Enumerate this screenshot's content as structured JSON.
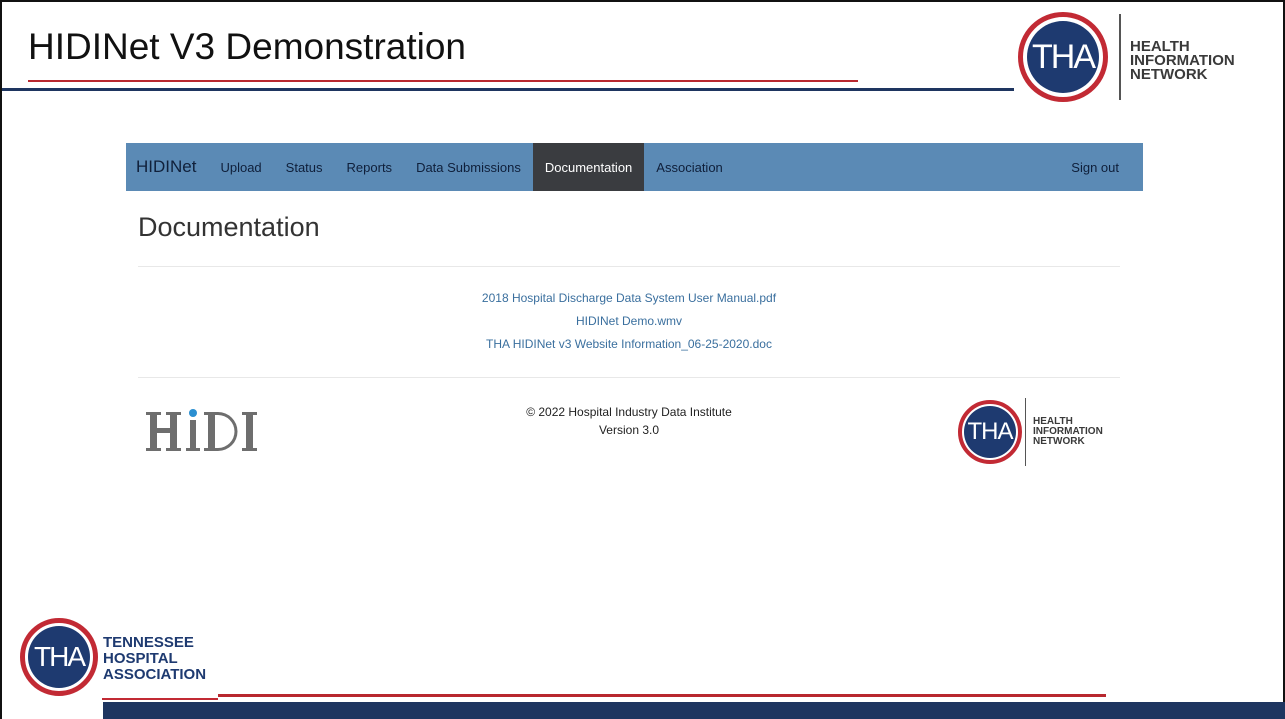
{
  "slide": {
    "title": "HIDINet V3 Demonstration",
    "header_logo": {
      "initials": "THA",
      "text_lines": [
        "HEALTH",
        "INFORMATION",
        "NETWORK"
      ]
    },
    "footer_logo": {
      "initials": "THA",
      "text_lines": [
        "TENNESSEE",
        "HOSPITAL",
        "ASSOCIATION"
      ]
    },
    "colors": {
      "navy": "#1e3560",
      "red": "#b8282f"
    }
  },
  "navbar": {
    "brand": "HIDINet",
    "items": [
      "Upload",
      "Status",
      "Reports",
      "Data Submissions",
      "Documentation",
      "Association"
    ],
    "active": "Documentation",
    "sign_out": "Sign out",
    "bg_color": "#5b8ab5",
    "active_color": "#3a3c40"
  },
  "page": {
    "heading": "Documentation",
    "links": [
      "2018 Hospital Discharge Data System User Manual.pdf",
      "HIDINet Demo.wmv",
      "THA HIDINet v3 Website Information_06-25-2020.doc"
    ],
    "link_color": "#3a6f9e"
  },
  "footer": {
    "copyright": "© 2022 Hospital Industry Data Institute",
    "version": "Version 3.0",
    "hidi_logo_text": "HIDI",
    "network_logo": {
      "initials": "THA",
      "text_lines": [
        "HEALTH",
        "INFORMATION",
        "NETWORK"
      ]
    }
  }
}
